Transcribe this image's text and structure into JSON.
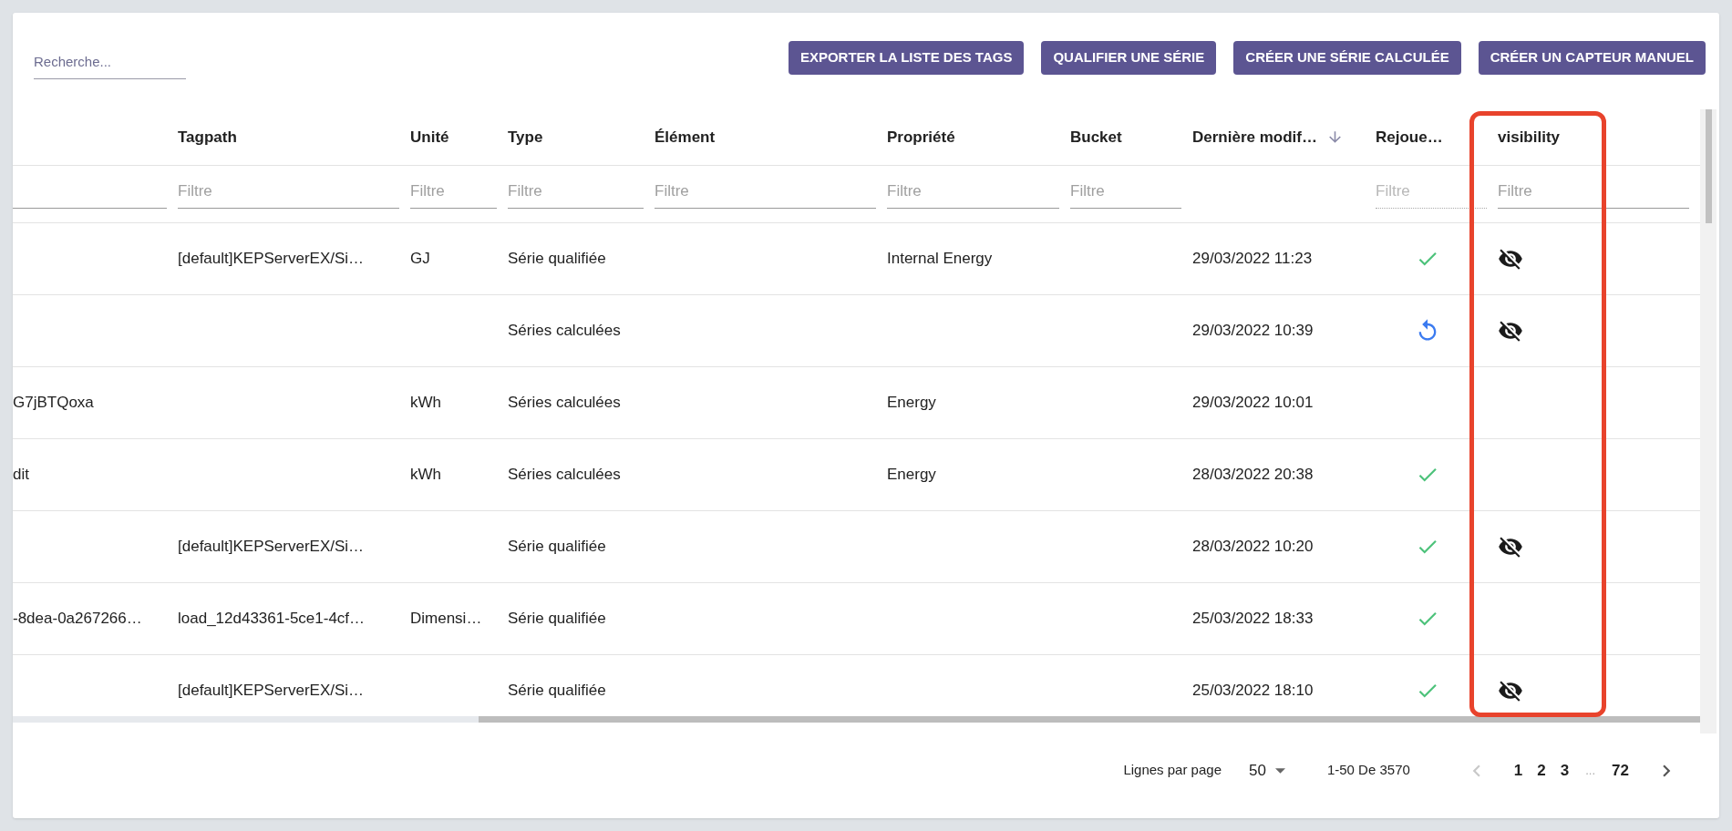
{
  "search": {
    "placeholder": "Recherche..."
  },
  "buttons": [
    "EXPORTER LA LISTE DES TAGS",
    "QUALIFIER UNE SÉRIE",
    "CRÉER UNE SÉRIE CALCULÉE",
    "CRÉER UN CAPTEUR MANUEL"
  ],
  "table": {
    "columns": [
      {
        "filter": {
          "disabled": false
        },
        "sorted": false
      },
      {
        "label": "Tagpath",
        "filter": {
          "placeholder": "Filtre",
          "disabled": false
        },
        "sorted": false
      },
      {
        "label": "Unité",
        "filter": {
          "placeholder": "Filtre",
          "disabled": false
        },
        "sorted": false
      },
      {
        "label": "Type",
        "filter": {
          "placeholder": "Filtre",
          "disabled": false
        },
        "sorted": false
      },
      {
        "label": "Élément",
        "filter": {
          "placeholder": "Filtre",
          "disabled": false
        },
        "sorted": false
      },
      {
        "label": "Propriété",
        "filter": {
          "placeholder": "Filtre",
          "disabled": false
        },
        "sorted": false
      },
      {
        "label": "Bucket",
        "filter": {
          "placeholder": "Filtre",
          "disabled": false
        },
        "sorted": false
      },
      {
        "label": "Dernière modif…",
        "sorted": true
      },
      {
        "label": "Rejoue…",
        "filter": {
          "placeholder": "Filtre",
          "disabled": true
        },
        "sorted": false
      },
      {
        "label": "visibility",
        "filter": {
          "placeholder": "Filtre",
          "disabled": false
        },
        "sorted": false
      }
    ],
    "rows": [
      {
        "cells": [
          "",
          "[default]KEPServerEX/Si…",
          "GJ",
          "Série qualifiée",
          "",
          "Internal Energy",
          "",
          "29/03/2022 11:23"
        ],
        "replay": {
          "kind": "check"
        },
        "hidden": true
      },
      {
        "cells": [
          "",
          "",
          "",
          "Séries calculées",
          "",
          "",
          "",
          "29/03/2022 10:39"
        ],
        "replay": {
          "kind": "retry"
        },
        "hidden": true
      },
      {
        "cells": [
          "G7jBTQoxa",
          "",
          "kWh",
          "Séries calculées",
          "",
          "Energy",
          "",
          "29/03/2022 10:01"
        ],
        "hidden": false
      },
      {
        "cells": [
          "dit",
          "",
          "kWh",
          "Séries calculées",
          "",
          "Energy",
          "",
          "28/03/2022 20:38"
        ],
        "replay": {
          "kind": "check"
        },
        "hidden": false
      },
      {
        "cells": [
          "",
          "[default]KEPServerEX/Si…",
          "",
          "Série qualifiée",
          "",
          "",
          "",
          "28/03/2022 10:20"
        ],
        "replay": {
          "kind": "check"
        },
        "hidden": true
      },
      {
        "cells": [
          "-8dea-0a267266…",
          "load_12d43361-5ce1-4cf…",
          "Dimensi…",
          "Série qualifiée",
          "",
          "",
          "",
          "25/03/2022 18:33"
        ],
        "replay": {
          "kind": "check"
        },
        "hidden": false
      },
      {
        "cells": [
          "",
          "[default]KEPServerEX/Si…",
          "",
          "Série qualifiée",
          "",
          "",
          "",
          "25/03/2022 18:10"
        ],
        "replay": {
          "kind": "check"
        },
        "hidden": true
      }
    ]
  },
  "pagination": {
    "rows_per_page_label": "Lignes par page",
    "rows_per_page": "50",
    "range": "1-50 De 3570",
    "prev_disabled": true,
    "next_disabled": false,
    "pages": [
      {
        "kind": "page",
        "label": "1"
      },
      {
        "kind": "page",
        "label": "2"
      },
      {
        "kind": "page",
        "label": "3"
      },
      {
        "kind": "ellipsis",
        "label": "..."
      },
      {
        "kind": "page",
        "label": "72"
      }
    ]
  }
}
